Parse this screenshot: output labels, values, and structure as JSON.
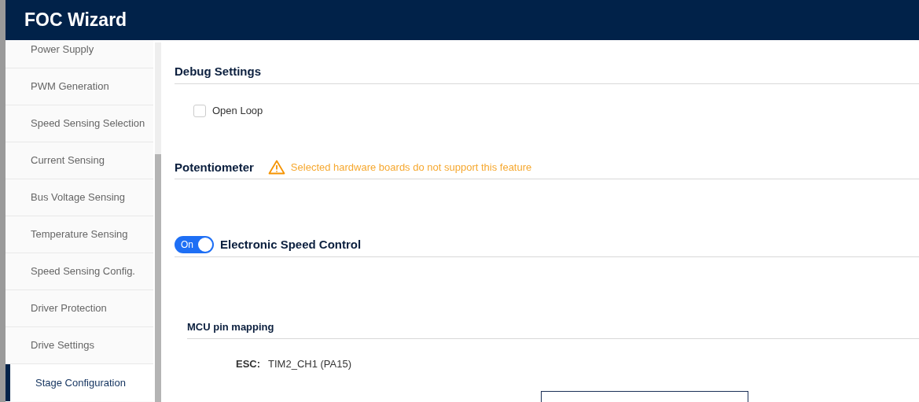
{
  "header": {
    "title": "FOC Wizard"
  },
  "sidebar": {
    "items": [
      {
        "label": "Power Supply",
        "selected": false
      },
      {
        "label": "PWM Generation",
        "selected": false
      },
      {
        "label": "Speed Sensing Selection",
        "selected": false
      },
      {
        "label": "Current Sensing",
        "selected": false
      },
      {
        "label": "Bus Voltage Sensing",
        "selected": false
      },
      {
        "label": "Temperature Sensing",
        "selected": false
      },
      {
        "label": "Speed Sensing Config.",
        "selected": false
      },
      {
        "label": "Driver Protection",
        "selected": false
      },
      {
        "label": "Drive Settings",
        "selected": false
      },
      {
        "label": "Stage Configuration",
        "selected": true
      }
    ]
  },
  "debug": {
    "title": "Debug Settings",
    "open_loop": {
      "label": "Open Loop",
      "checked": false
    }
  },
  "potentiometer": {
    "title": "Potentiometer",
    "warning": "Selected hardware boards do not support this feature"
  },
  "esc": {
    "title": "Electronic Speed Control",
    "toggle": {
      "label": "On",
      "on": true
    },
    "pin_mapping": {
      "title": "MCU pin mapping",
      "label": "ESC:",
      "value": "TIM2_CH1 (PA15)"
    }
  }
}
